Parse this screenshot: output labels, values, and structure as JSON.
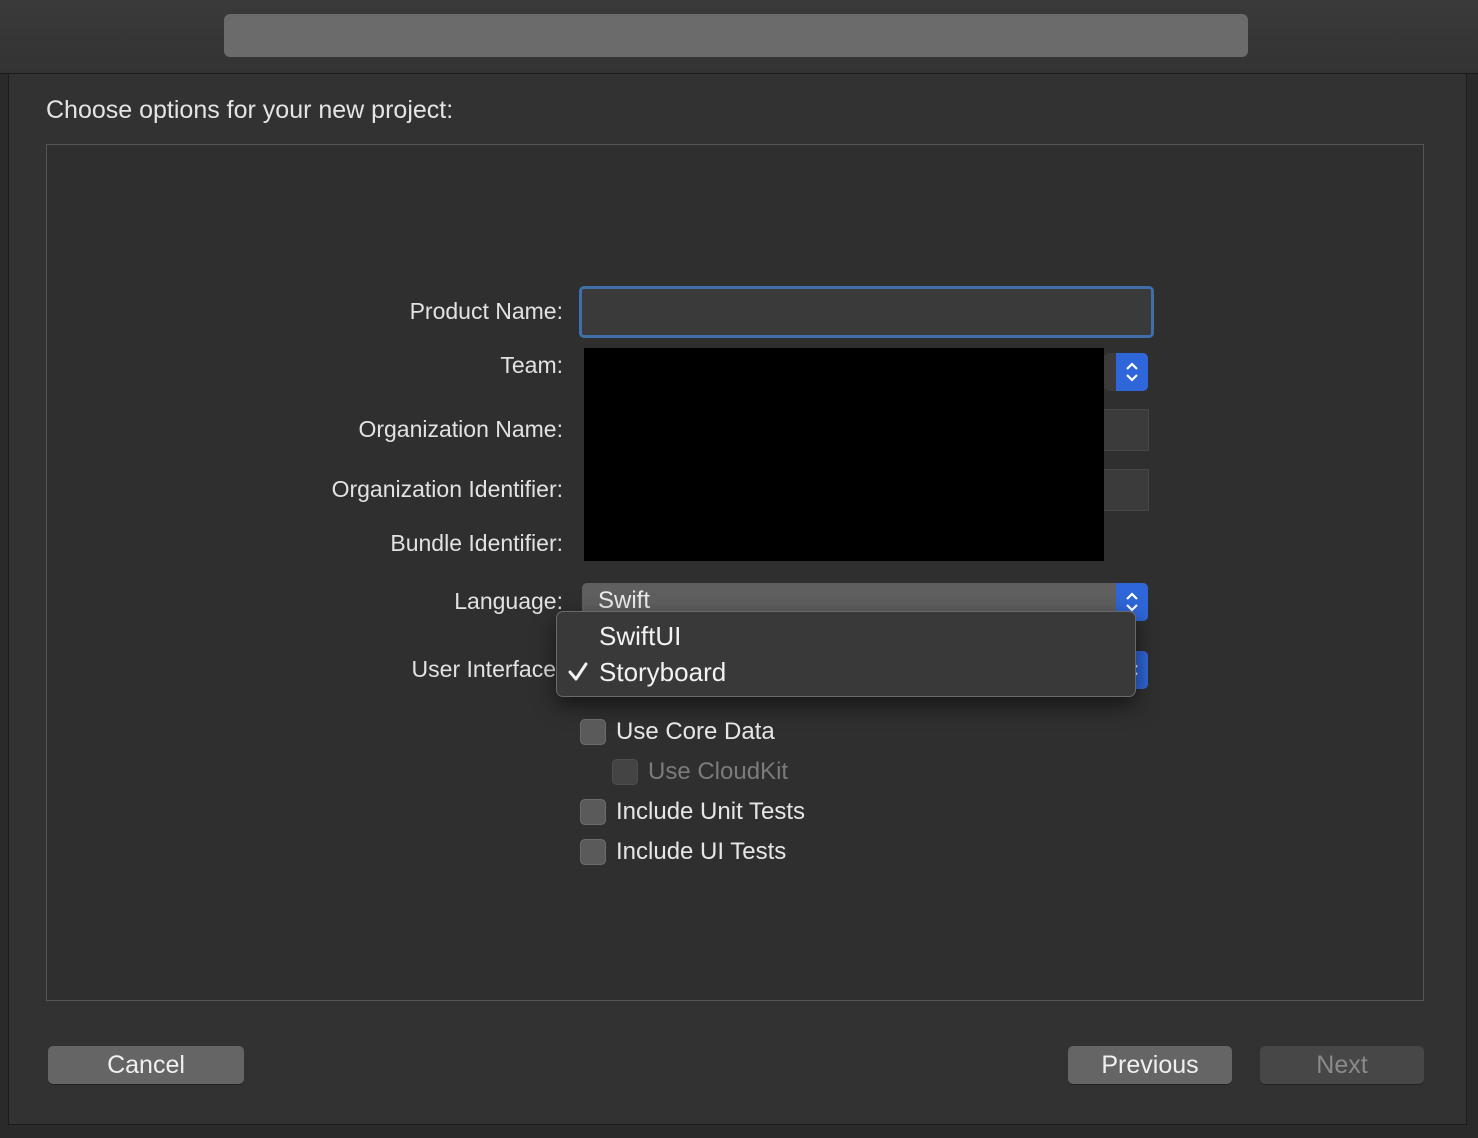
{
  "window": {
    "heading": "Choose options for your new project:"
  },
  "form": {
    "product_name": {
      "label": "Product Name:",
      "value": "",
      "placeholder": ""
    },
    "team": {
      "label": "Team:"
    },
    "organization_name": {
      "label": "Organization Name:"
    },
    "organization_identifier": {
      "label": "Organization Identifier:"
    },
    "bundle_identifier": {
      "label": "Bundle Identifier:"
    },
    "language": {
      "label": "Language:",
      "value": "Swift"
    },
    "user_interface": {
      "label": "User Interface"
    }
  },
  "ui_menu": {
    "items": [
      {
        "label": "SwiftUI",
        "checked": false
      },
      {
        "label": "Storyboard",
        "checked": true
      }
    ]
  },
  "checkboxes": {
    "core_data": {
      "label": "Use Core Data",
      "checked": false
    },
    "cloudkit": {
      "label": "Use CloudKit",
      "checked": false,
      "disabled": true
    },
    "unit_tests": {
      "label": "Include Unit Tests",
      "checked": false
    },
    "ui_tests": {
      "label": "Include UI Tests",
      "checked": false
    }
  },
  "buttons": {
    "cancel": "Cancel",
    "previous": "Previous",
    "next": "Next"
  },
  "colors": {
    "accent": "#2f66d9",
    "focus_ring": "#3f6fa8"
  }
}
